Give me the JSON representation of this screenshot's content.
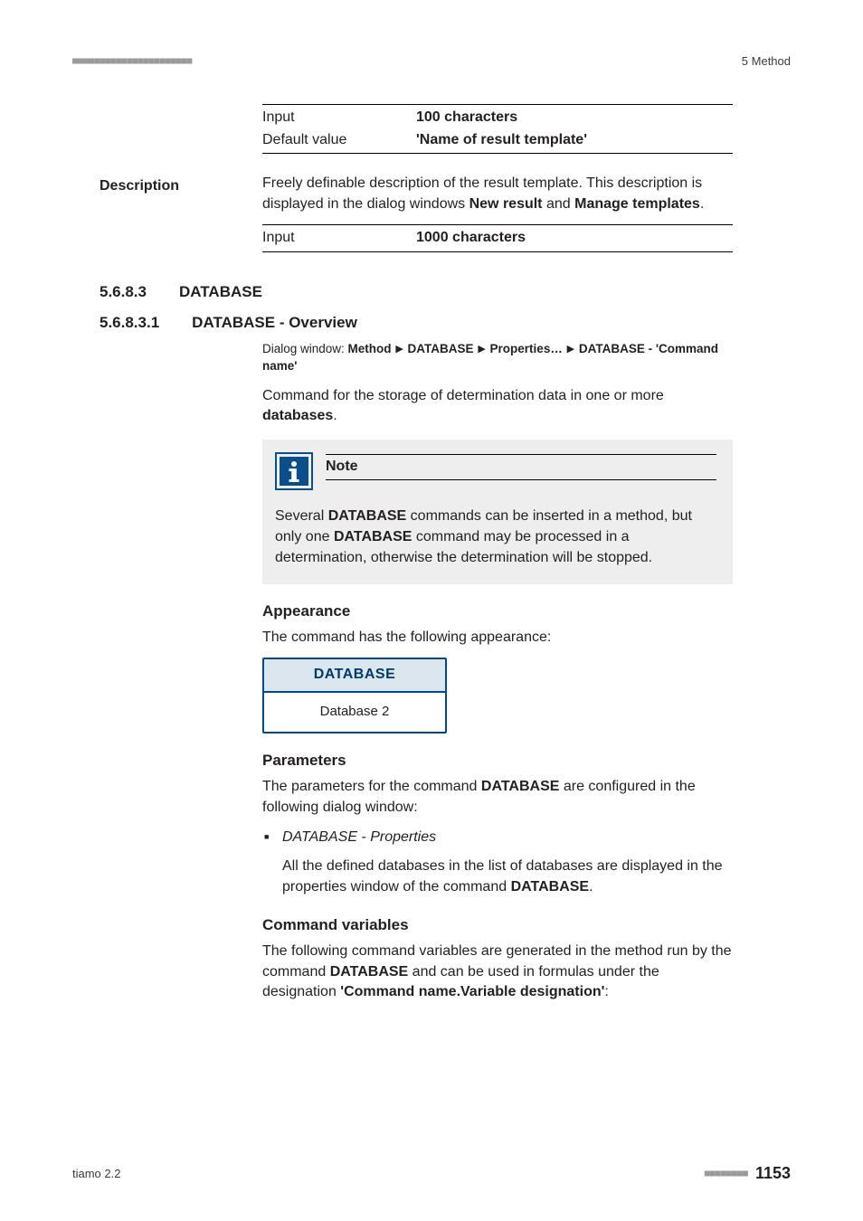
{
  "header": {
    "left_dots": "■■■■■■■■■■■■■■■■■■■■■■",
    "right": "5 Method"
  },
  "tbl_top": {
    "r1": {
      "l": "Input",
      "r": "100 characters"
    },
    "r2": {
      "l": "Default value",
      "r": "'Name of result template'"
    }
  },
  "desc": {
    "heading": "Description",
    "para": [
      "Freely definable description of the result template. This description is dis",
      "played in the dialog windows ",
      "New result",
      " and ",
      "Manage templates",
      "."
    ],
    "row": {
      "l": "Input",
      "r": "1000 characters"
    }
  },
  "s5683": {
    "num": "5.6.8.3",
    "title": "DATABASE"
  },
  "s56831": {
    "num": "5.6.8.3.1",
    "title": "DATABASE - Overview",
    "dlg": {
      "prefix": "Dialog window: ",
      "c1": "Method",
      "c2": "DATABASE",
      "c3": "Properties…",
      "c4": "DATABASE - 'Command name'"
    },
    "cmd_para_parts": [
      "Command for the storage of determination data in one or more ",
      "databa",
      "ses",
      "."
    ]
  },
  "note": {
    "title": "Note",
    "body_parts": [
      "Several ",
      "DATABASE",
      " commands can be inserted in a method, but only one ",
      "DATABASE",
      " command may be processed in a determination, otherwise the determination will be stopped."
    ]
  },
  "appearance": {
    "heading": "Appearance",
    "text": "The command has the following appearance:",
    "card_title": "DATABASE",
    "card_body": "Database 2"
  },
  "parameters": {
    "heading": "Parameters",
    "lead_parts": [
      "The parameters for the command ",
      "DATABASE",
      " are configured in the following dialog window:"
    ],
    "item_title": "DATABASE - Properties",
    "item_body_parts": [
      "All the defined databases in the list of databases are displayed in the properties window of the command ",
      "DATABASE",
      "."
    ]
  },
  "cmdvars": {
    "heading": "Command variables",
    "body_parts": [
      "The following command variables are generated in the method run by the command ",
      "DATABASE",
      " and can be used in formulas under the designation ",
      "'Command name.Variable designation'",
      ":"
    ]
  },
  "footer": {
    "left": "tiamo 2.2",
    "dots": "■■■■■■■■",
    "page": "1153"
  }
}
